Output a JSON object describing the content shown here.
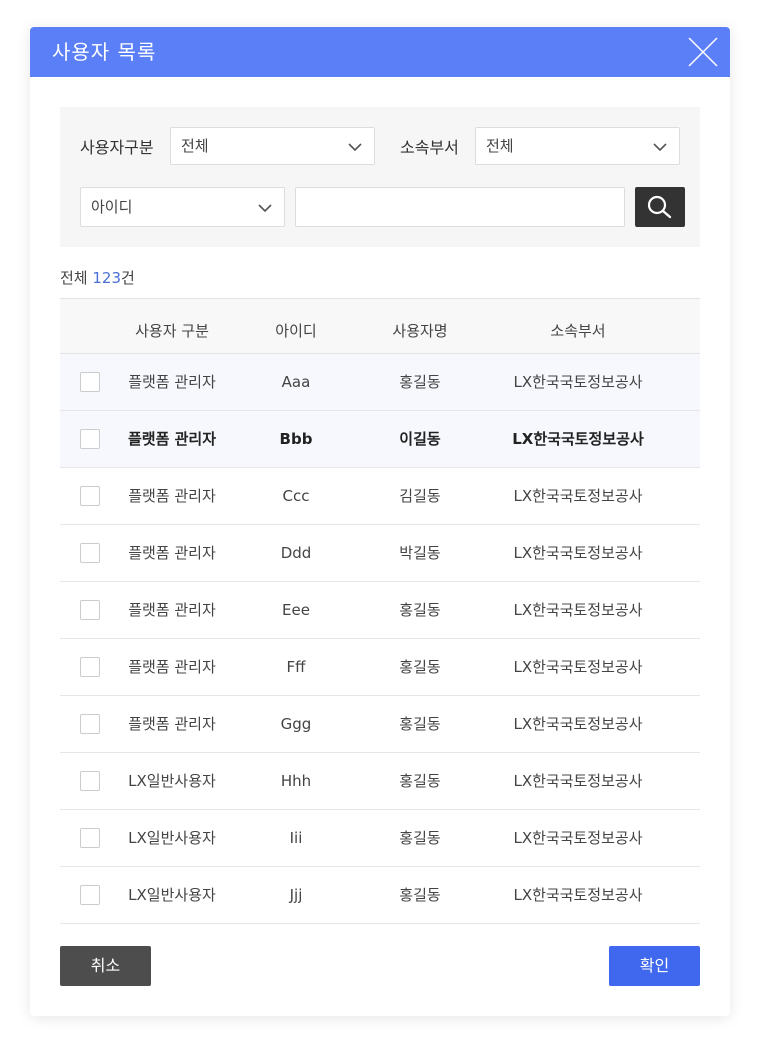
{
  "modal": {
    "title": "사용자 목록"
  },
  "filters": {
    "user_type_label": "사용자구분",
    "user_type_value": "전체",
    "dept_label": "소속부서",
    "dept_value": "전체",
    "search_field_value": "아이디",
    "search_input_value": "",
    "search_icon": "search-icon"
  },
  "summary": {
    "prefix": "전체",
    "count": "123",
    "suffix": "건"
  },
  "table": {
    "headers": [
      "사용자 구분",
      "아이디",
      "사용자명",
      "소속부서"
    ],
    "rows": [
      {
        "type": "플랫폼 관리자",
        "id": "Aaa",
        "name": "홍길동",
        "dept": "LX한국국토정보공사"
      },
      {
        "type": "플랫폼 관리자",
        "id": "Bbb",
        "name": "이길동",
        "dept": "LX한국국토정보공사"
      },
      {
        "type": "플랫폼 관리자",
        "id": "Ccc",
        "name": "김길동",
        "dept": "LX한국국토정보공사"
      },
      {
        "type": "플랫폼 관리자",
        "id": "Ddd",
        "name": "박길동",
        "dept": "LX한국국토정보공사"
      },
      {
        "type": "플랫폼 관리자",
        "id": "Eee",
        "name": "홍길동",
        "dept": "LX한국국토정보공사"
      },
      {
        "type": "플랫폼 관리자",
        "id": "Fff",
        "name": "홍길동",
        "dept": "LX한국국토정보공사"
      },
      {
        "type": "플랫폼 관리자",
        "id": "Ggg",
        "name": "홍길동",
        "dept": "LX한국국토정보공사"
      },
      {
        "type": "LX일반사용자",
        "id": "Hhh",
        "name": "홍길동",
        "dept": "LX한국국토정보공사"
      },
      {
        "type": "LX일반사용자",
        "id": "Iii",
        "name": "홍길동",
        "dept": "LX한국국토정보공사"
      },
      {
        "type": "LX일반사용자",
        "id": "Jjj",
        "name": "홍길동",
        "dept": "LX한국국토정보공사"
      }
    ]
  },
  "footer": {
    "cancel_label": "취소",
    "ok_label": "확인"
  },
  "colors": {
    "header_bg": "#5b7ff7",
    "ok_button": "#3f68ee",
    "cancel_button": "#4d4d4d",
    "count_accent": "#4a6fd8"
  }
}
